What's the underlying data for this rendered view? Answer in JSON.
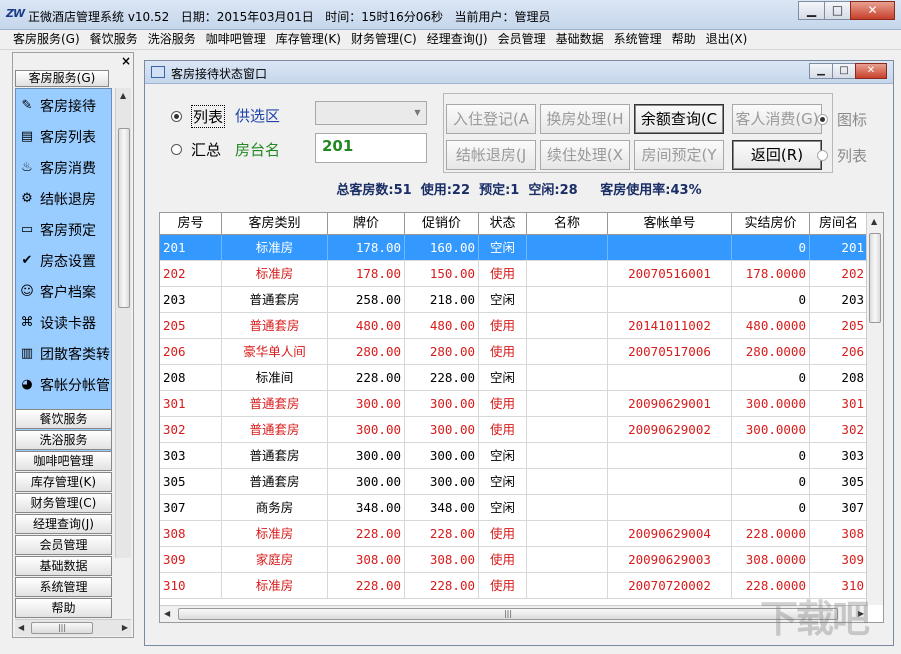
{
  "title_bar": {
    "logo": "ZW",
    "text": "正微酒店管理系统 v10.52   日期：2015年03月01日   时间：15时16分06秒   当前用户：管理员"
  },
  "menu": [
    "客房服务(G)",
    "餐饮服务",
    "洗浴服务",
    "咖啡吧管理",
    "库存管理(K)",
    "财务管理(C)",
    "经理查询(J)",
    "会员管理",
    "基础数据",
    "系统管理",
    "帮助",
    "退出(X)"
  ],
  "sidebar": {
    "close": "×",
    "header": "客房服务(G)",
    "items": [
      {
        "label": "客房接待",
        "icon": "pen-icon"
      },
      {
        "label": "客房列表",
        "icon": "list-icon"
      },
      {
        "label": "客房消费",
        "icon": "consume-icon"
      },
      {
        "label": "结帐退房",
        "icon": "checkout-icon"
      },
      {
        "label": "客房预定",
        "icon": "reserve-icon"
      },
      {
        "label": "房态设置",
        "icon": "status-icon"
      },
      {
        "label": "客户档案",
        "icon": "customer-icon"
      },
      {
        "label": "设读卡器",
        "icon": "card-reader-icon"
      },
      {
        "label": "团散客类转",
        "icon": "group-icon"
      },
      {
        "label": "客帐分帐管",
        "icon": "split-account-icon"
      }
    ],
    "buttons": [
      "餐饮服务",
      "洗浴服务",
      "咖啡吧管理",
      "库存管理(K)",
      "财务管理(C)",
      "经理查询(J)",
      "会员管理",
      "基础数据",
      "系统管理",
      "帮助"
    ]
  },
  "window": {
    "title": "客房接待状态窗口",
    "radio_list": "列表",
    "radio_summary": "汇总",
    "filter_label": "供选区",
    "room_label": "房台名",
    "room_value": "201",
    "buttons": {
      "checkin": "入住登记(A",
      "change_room": "换房处理(H",
      "balance": "余额查询(C",
      "guest_consume": "客人消费(G)",
      "checkout": "结帐退房(J",
      "extend": "续住处理(X",
      "reserve": "房间预定(Y",
      "back": "返回(R)"
    },
    "view_icon": "图标",
    "view_list": "列表",
    "summary": "总客房数:51  使用:22  预定:1  空闲:28     客房使用率:43%",
    "columns": [
      "房号",
      "客房类别",
      "牌价",
      "促销价",
      "状态",
      "名称",
      "客帐单号",
      "实结房价",
      "房间名"
    ],
    "rows": [
      [
        "201",
        "标准房",
        "178.00",
        "160.00",
        "空闲",
        "",
        "",
        "0",
        "201"
      ],
      [
        "202",
        "标准房",
        "178.00",
        "150.00",
        "使用",
        "",
        "20070516001",
        "178.0000",
        "202"
      ],
      [
        "203",
        "普通套房",
        "258.00",
        "218.00",
        "空闲",
        "",
        "",
        "0",
        "203"
      ],
      [
        "205",
        "普通套房",
        "480.00",
        "480.00",
        "使用",
        "",
        "20141011002",
        "480.0000",
        "205"
      ],
      [
        "206",
        "豪华单人间",
        "280.00",
        "280.00",
        "使用",
        "",
        "20070517006",
        "280.0000",
        "206"
      ],
      [
        "208",
        "标准间",
        "228.00",
        "228.00",
        "空闲",
        "",
        "",
        "0",
        "208"
      ],
      [
        "301",
        "普通套房",
        "300.00",
        "300.00",
        "使用",
        "",
        "20090629001",
        "300.0000",
        "301"
      ],
      [
        "302",
        "普通套房",
        "300.00",
        "300.00",
        "使用",
        "",
        "20090629002",
        "300.0000",
        "302"
      ],
      [
        "303",
        "普通套房",
        "300.00",
        "300.00",
        "空闲",
        "",
        "",
        "0",
        "303"
      ],
      [
        "305",
        "普通套房",
        "300.00",
        "300.00",
        "空闲",
        "",
        "",
        "0",
        "305"
      ],
      [
        "307",
        "商务房",
        "348.00",
        "348.00",
        "空闲",
        "",
        "",
        "0",
        "307"
      ],
      [
        "308",
        "标准房",
        "228.00",
        "228.00",
        "使用",
        "",
        "20090629004",
        "228.0000",
        "308"
      ],
      [
        "309",
        "家庭房",
        "308.00",
        "308.00",
        "使用",
        "",
        "20090629003",
        "308.0000",
        "309"
      ],
      [
        "310",
        "标准房",
        "228.00",
        "228.00",
        "使用",
        "",
        "20070720002",
        "228.0000",
        "310"
      ]
    ]
  },
  "colors": {
    "selected": "#3399ff",
    "occupied": "#d81b1b",
    "sidebar_blue": "#99ccff",
    "summary": "#1a2e66"
  },
  "watermark": "下载吧"
}
